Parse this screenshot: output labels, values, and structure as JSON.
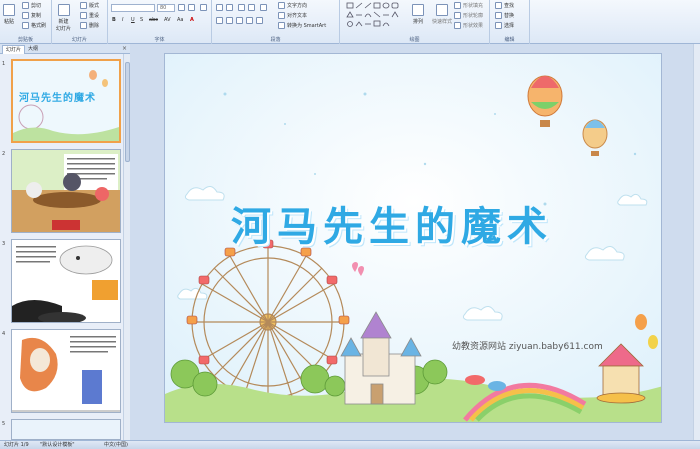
{
  "ribbon": {
    "clipboard": {
      "paste": "粘贴",
      "cut": "剪切",
      "copy": "复制",
      "format_painter": "格式刷",
      "label": "剪贴板"
    },
    "slides": {
      "new_slide": "新建\n幻灯片",
      "layout": "版式",
      "reset": "重设",
      "delete": "删除",
      "label": "幻灯片"
    },
    "font": {
      "font_name": "",
      "font_size": "80",
      "bold": "B",
      "italic": "I",
      "underline": "U",
      "shadow": "S",
      "strike": "abc",
      "spacing": "AV",
      "case": "Aa",
      "color": "A",
      "label": "字体"
    },
    "paragraph": {
      "text_direction": "文字方向",
      "align_text": "对齐文本",
      "convert_smartart": "转换为 SmartArt",
      "label": "段落"
    },
    "drawing": {
      "arrange": "排列",
      "quick_styles": "快速样式",
      "shape_fill": "形状填充",
      "shape_outline": "形状轮廓",
      "shape_effects": "形状效果",
      "label": "绘图"
    },
    "editing": {
      "find": "查找",
      "replace": "替换",
      "select": "选择",
      "label": "编辑"
    }
  },
  "panel": {
    "tabs": [
      "幻灯片",
      "大纲"
    ],
    "close": "×",
    "thumbs": [
      {
        "num": "1",
        "title": "河马先生的魔术"
      },
      {
        "num": "2",
        "title": ""
      },
      {
        "num": "3",
        "title": ""
      },
      {
        "num": "4",
        "title": ""
      },
      {
        "num": "5",
        "title": ""
      }
    ]
  },
  "slide": {
    "title": "河马先生的魔术",
    "credit": "幼教资源网站  ziyuan.baby611.com"
  },
  "status": {
    "slide_count": "幻灯片 1/9",
    "theme": "\"默认设计模板\"",
    "language": "中文(中国)"
  },
  "colors": {
    "title": "#2fa9e4",
    "selected_thumb": "#f0a14a"
  }
}
